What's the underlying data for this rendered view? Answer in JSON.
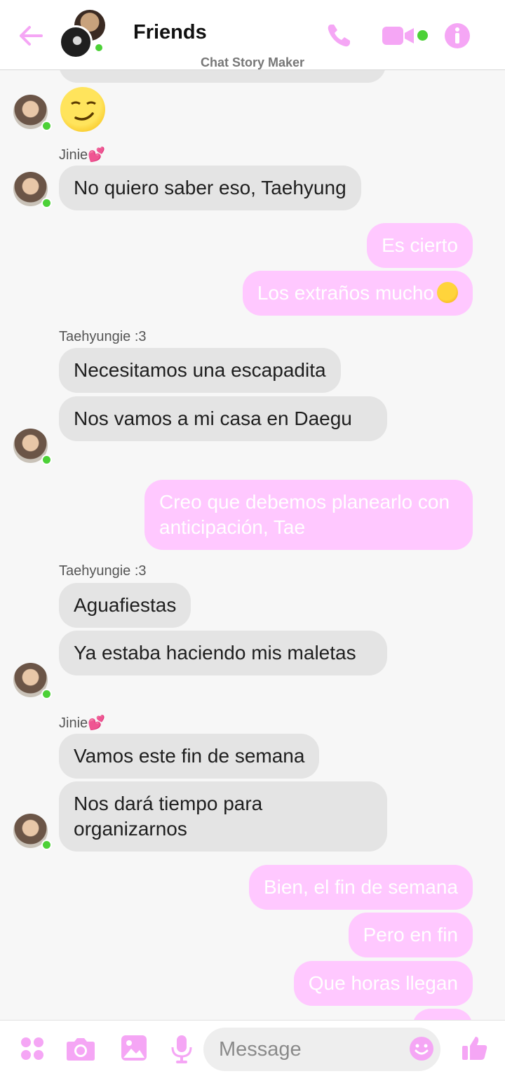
{
  "header": {
    "title": "Friends",
    "watermark": "Chat Story Maker"
  },
  "colors": {
    "accent": "#ffc8ff",
    "icon": "#f5a6f5",
    "online": "#4cd137",
    "received_bubble": "#e4e4e4"
  },
  "icons": [
    "back-arrow-icon",
    "phone-icon",
    "video-icon",
    "info-icon",
    "grid-icon",
    "camera-icon",
    "image-icon",
    "mic-icon",
    "smile-icon",
    "thumbs-up-icon"
  ],
  "messages": [
    {
      "type": "recv",
      "emoji": "smirking-face"
    },
    {
      "sender": "Jinie💕"
    },
    {
      "type": "recv",
      "text": "No quiero saber eso, Taehyung"
    },
    {
      "type": "sent",
      "text": "Es cierto"
    },
    {
      "type": "sent",
      "text": "Los extraños mucho"
    },
    {
      "sender": "Taehyungie :3"
    },
    {
      "type": "recv",
      "text": "Necesitamos una escapadita"
    },
    {
      "type": "recv",
      "text": "Nos vamos a mi casa en Daegu"
    },
    {
      "type": "sent",
      "text": "Creo que debemos planearlo con anticipación, Tae"
    },
    {
      "sender": "Taehyungie :3"
    },
    {
      "type": "recv",
      "text": "Aguafiestas"
    },
    {
      "type": "recv",
      "text": "Ya estaba haciendo mis maletas"
    },
    {
      "sender": "Jinie💕"
    },
    {
      "type": "recv",
      "text": "Vamos este fin de semana"
    },
    {
      "type": "recv",
      "text": "Nos dará tiempo para organizarnos"
    },
    {
      "type": "sent",
      "text": "Bien, el fin de semana"
    },
    {
      "type": "sent",
      "text": "Pero en fin"
    },
    {
      "type": "sent",
      "text": "Que horas llegan"
    }
  ],
  "composer": {
    "placeholder": "Message"
  }
}
